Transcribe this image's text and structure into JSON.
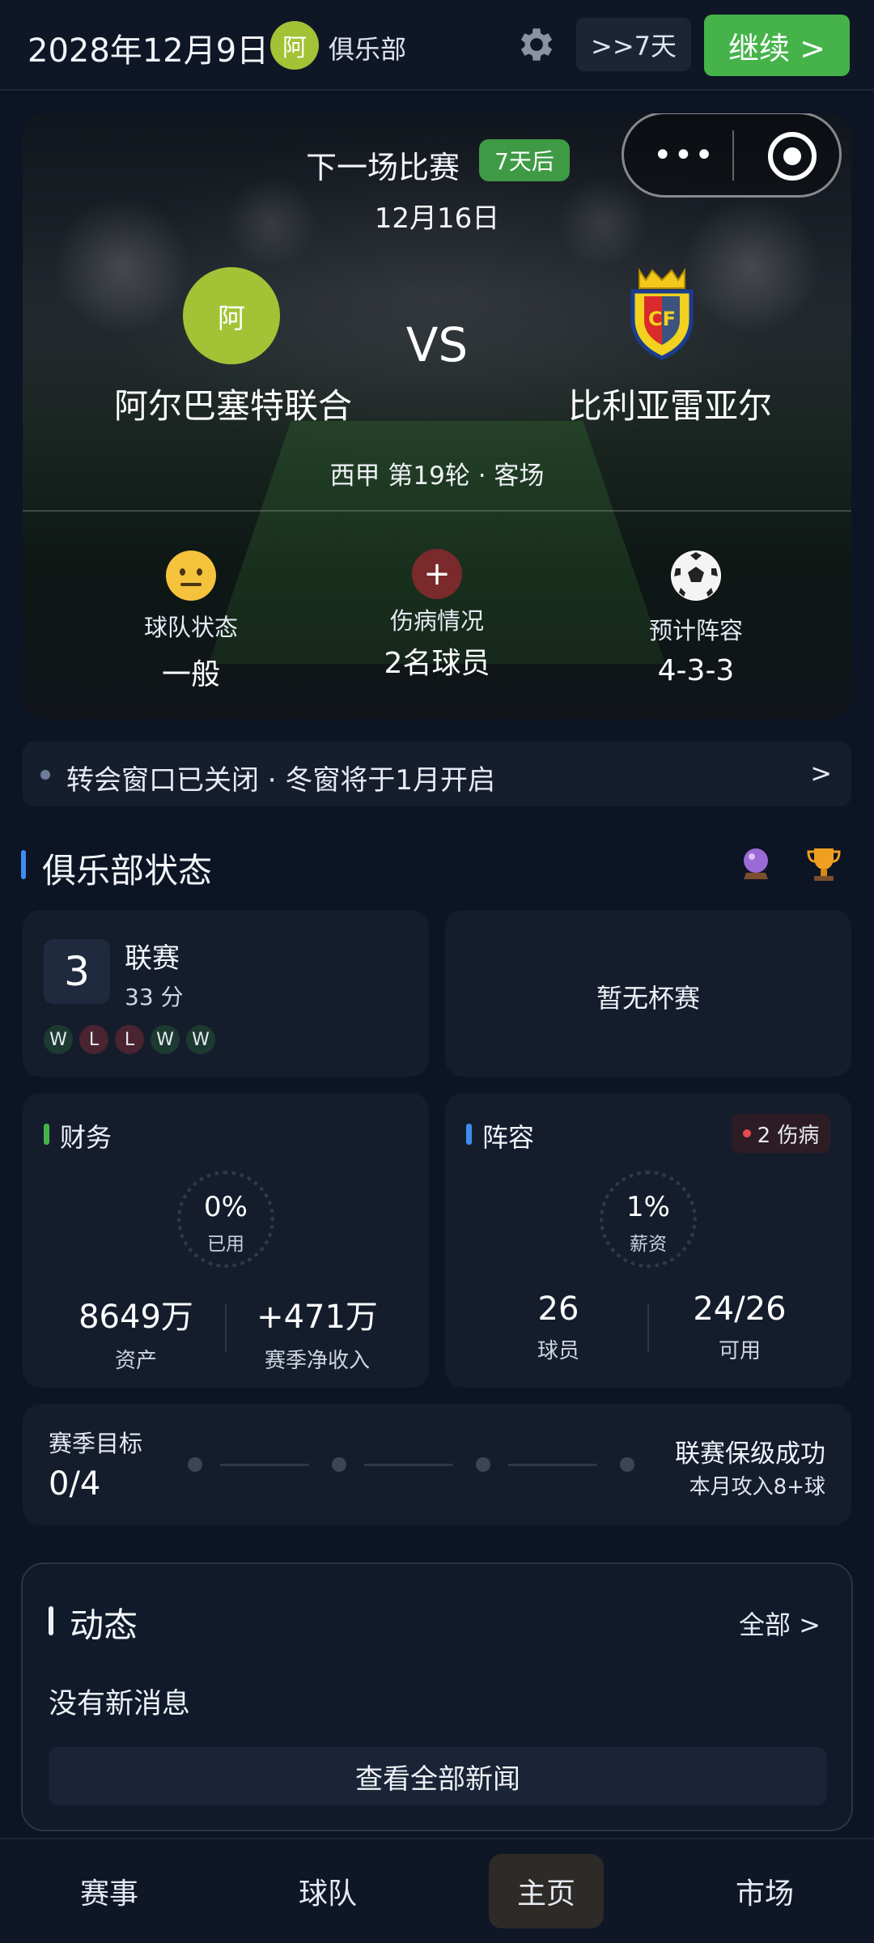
{
  "topbar": {
    "date": "2028年12月9日",
    "club_chip": "阿",
    "club_label": "俱乐部",
    "skip_label": ">>7天",
    "continue_label": "继续 >"
  },
  "match": {
    "title": "下一场比赛",
    "days_badge": "7天后",
    "date": "12月16日",
    "home_logo_text": "阿",
    "home_name": "阿尔巴塞特联合",
    "vs": "VS",
    "away_name": "比利亚雷亚尔",
    "league_line": "西甲 第19轮  ·  客场",
    "stats": [
      {
        "label": "球队状态",
        "value": "一般"
      },
      {
        "label": "伤病情况",
        "value": "2名球员"
      },
      {
        "label": "预计阵容",
        "value": "4-3-3"
      }
    ]
  },
  "transfer_banner": {
    "text": "转会窗口已关闭 · 冬窗将于1月开启",
    "chevron": ">"
  },
  "club_status": {
    "title": "俱乐部状态",
    "league": {
      "rank": "3",
      "name": "联赛",
      "points": "33 分",
      "form": [
        "W",
        "L",
        "L",
        "W",
        "W"
      ]
    },
    "cup": {
      "text": "暂无杯赛"
    },
    "finance": {
      "title": "财务",
      "ring_value": "0%",
      "ring_label": "已用",
      "metrics": [
        {
          "value": "8649万",
          "label": "资产"
        },
        {
          "value": "+471万",
          "label": "赛季净收入"
        }
      ]
    },
    "squad": {
      "title": "阵容",
      "injury_badge": "2 伤病",
      "ring_value": "1%",
      "ring_label": "薪资",
      "metrics": [
        {
          "value": "26",
          "label": "球员"
        },
        {
          "value": "24/26",
          "label": "可用"
        }
      ]
    },
    "season_goal": {
      "title": "赛季目标",
      "progress": "0/4",
      "goal_name": "联赛保级成功",
      "goal_desc": "本月攻入8+球"
    }
  },
  "news": {
    "title": "动态",
    "all_link": "全部 >",
    "empty_text": "没有新消息",
    "view_all_button": "查看全部新闻"
  },
  "bottom_nav": [
    "赛事",
    "球队",
    "主页",
    "市场"
  ],
  "colors": {
    "background": "#0d1424",
    "accent_green": "#45b349",
    "club_color": "#a3c235",
    "finance_bar": "#45b349",
    "squad_bar": "#3d8cf0",
    "injury_red": "#e84a50"
  }
}
